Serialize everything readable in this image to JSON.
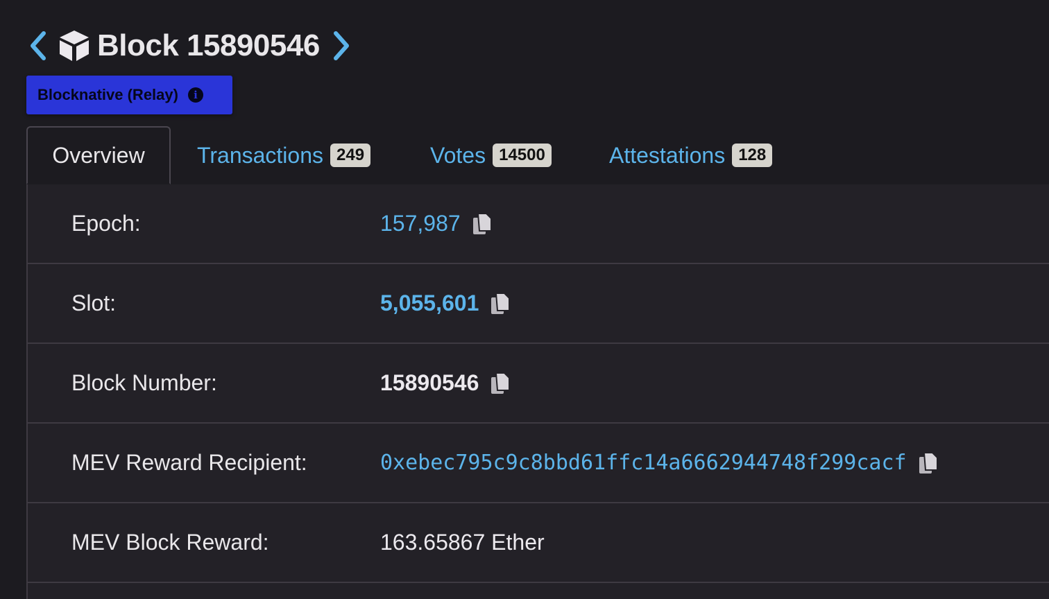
{
  "header": {
    "prev_icon": "chevron-left-icon",
    "block_icon": "cube-icon",
    "title": "Block 15890546",
    "next_icon": "chevron-right-icon"
  },
  "badge": {
    "label": "Blocknative (Relay)",
    "info_icon": "info-icon",
    "info_glyph": "i"
  },
  "tabs": [
    {
      "label": "Overview",
      "active": true
    },
    {
      "label": "Transactions",
      "count": "249"
    },
    {
      "label": "Votes",
      "count": "14500"
    },
    {
      "label": "Attestations",
      "count": "128"
    }
  ],
  "rows": [
    {
      "label": "Epoch:",
      "value": "157,987",
      "copy": true
    },
    {
      "label": "Slot:",
      "value": "5,055,601",
      "copy": true
    },
    {
      "label": "Block Number:",
      "value": "15890546",
      "copy": true
    },
    {
      "label": "MEV Reward Recipient:",
      "value": "0xebec795c9c8bbd61ffc14a6662944748f299cacf",
      "copy": true
    },
    {
      "label": "MEV Block Reward:",
      "value": "163.65867 Ether"
    }
  ],
  "colors": {
    "background": "#1c1b20",
    "panel": "#232127",
    "link": "#5cb4ea",
    "badge": "#2a35d8",
    "count_badge": "#d6d4cd"
  }
}
